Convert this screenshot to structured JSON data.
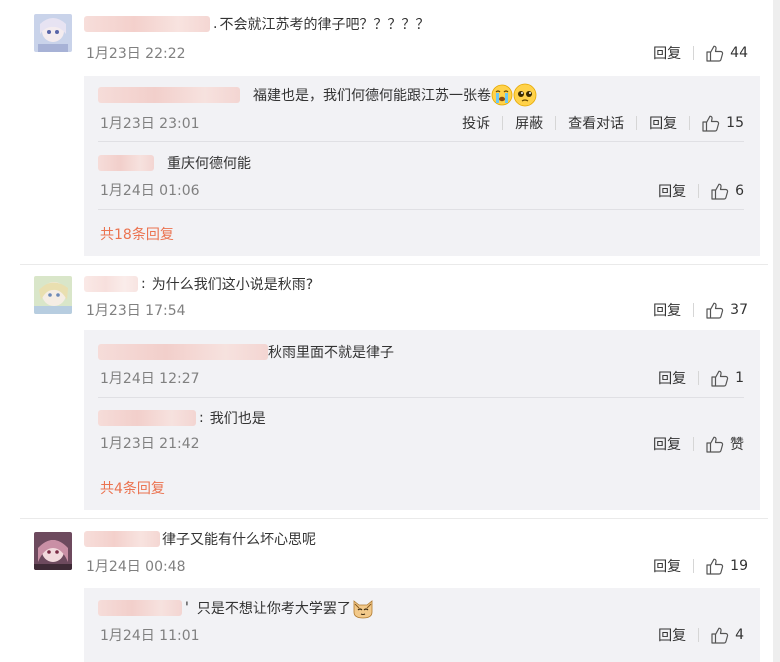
{
  "colors": {
    "link": "#eb7350",
    "meta": "#808080",
    "text": "#333333",
    "reply_bg": "#f2f2f5"
  },
  "threads": [
    {
      "comment": {
        "text": "不会就江苏考的律子吧？？？？？",
        "time": "1月23日 22:22",
        "reply_label": "回复",
        "likes": "44"
      },
      "replies": [
        {
          "text": "福建也是，我们何德何能跟江苏一张卷",
          "emojis": [
            "crying-emoji",
            "pleading-emoji"
          ],
          "time": "1月23日 23:01",
          "actions": [
            "投诉",
            "屏蔽",
            "查看对话",
            "回复"
          ],
          "likes": "15"
        },
        {
          "text": "重庆何德何能",
          "time": "1月24日 01:06",
          "actions": [
            "回复"
          ],
          "likes": "6"
        }
      ],
      "more": "共18条回复"
    },
    {
      "comment": {
        "text": "为什么我们这小说是秋雨?",
        "time": "1月23日 17:54",
        "reply_label": "回复",
        "likes": "37"
      },
      "replies": [
        {
          "text": "秋雨里面不就是律子",
          "time": "1月24日 12:27",
          "actions": [
            "回复"
          ],
          "likes": "1"
        },
        {
          "text": "我们也是",
          "time": "1月23日 21:42",
          "actions": [
            "回复"
          ],
          "likes": "赞"
        }
      ],
      "more": "共4条回复"
    },
    {
      "comment": {
        "text": "律子又能有什么坏心思呢",
        "time": "1月24日 00:48",
        "reply_label": "回复",
        "likes": "19"
      },
      "replies": [
        {
          "text": "只是不想让你考大学罢了",
          "emojis": [
            "cat-emoji"
          ],
          "time": "1月24日 11:01",
          "actions": [
            "回复"
          ],
          "likes": "4"
        }
      ]
    }
  ],
  "icons": {
    "like": "thumbs-up-icon",
    "avatar": "user-avatar"
  }
}
